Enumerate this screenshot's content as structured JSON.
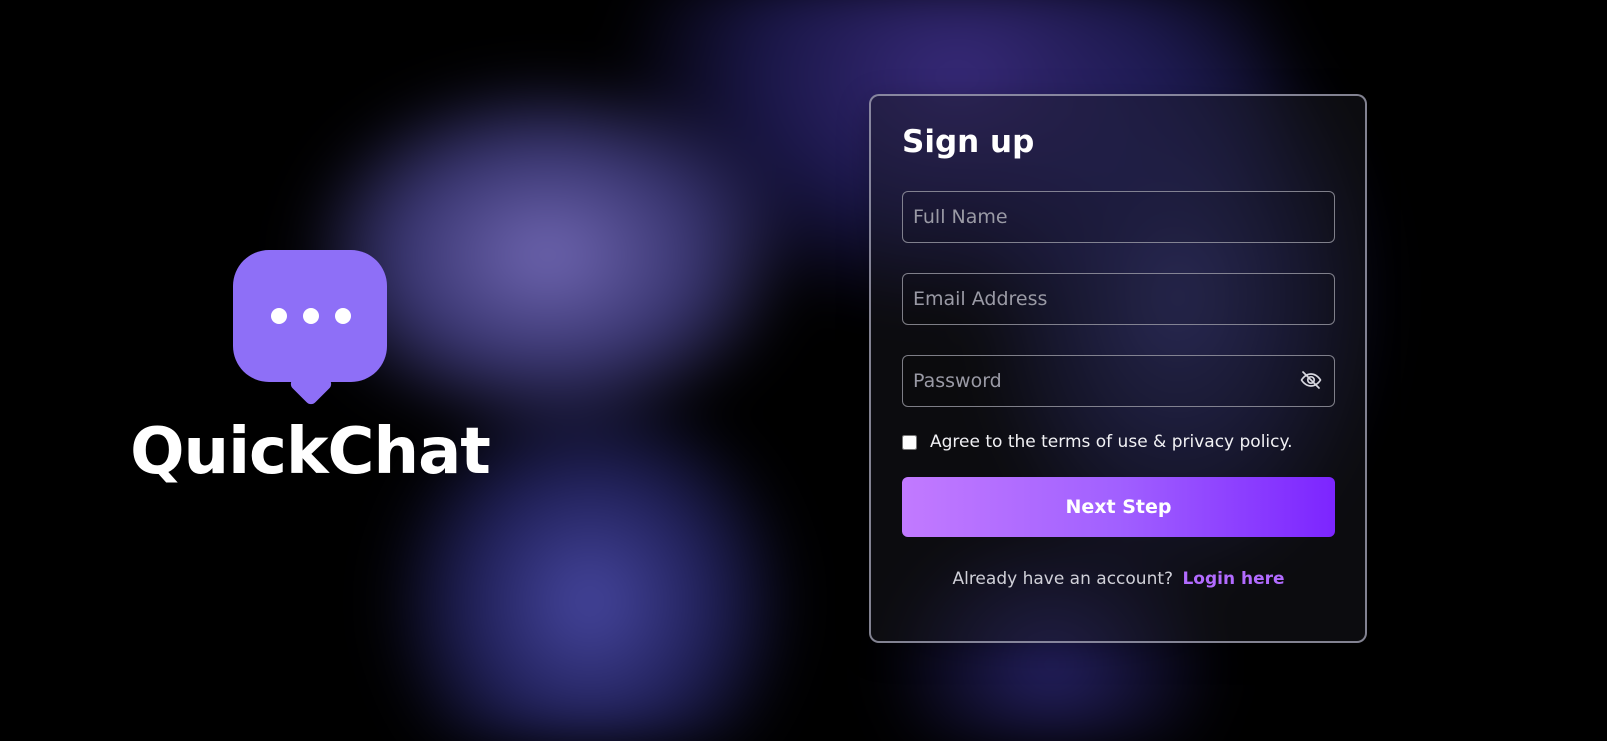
{
  "app": {
    "name": "QuickChat"
  },
  "signup": {
    "title": "Sign up",
    "full_name_placeholder": "Full Name",
    "email_placeholder": "Email Address",
    "password_placeholder": "Password",
    "terms_label": "Agree to the terms of use & privacy policy.",
    "next_button_label": "Next Step",
    "login_prompt": "Already have an account?",
    "login_link": "Login here"
  },
  "icons": {
    "logo": "chat-bubble-icon",
    "password_visibility": "eye-off-icon"
  },
  "colors": {
    "brand": "#8e6ff7",
    "button_start": "#c27aff",
    "button_end": "#7c25ff",
    "link": "#b26bff"
  }
}
